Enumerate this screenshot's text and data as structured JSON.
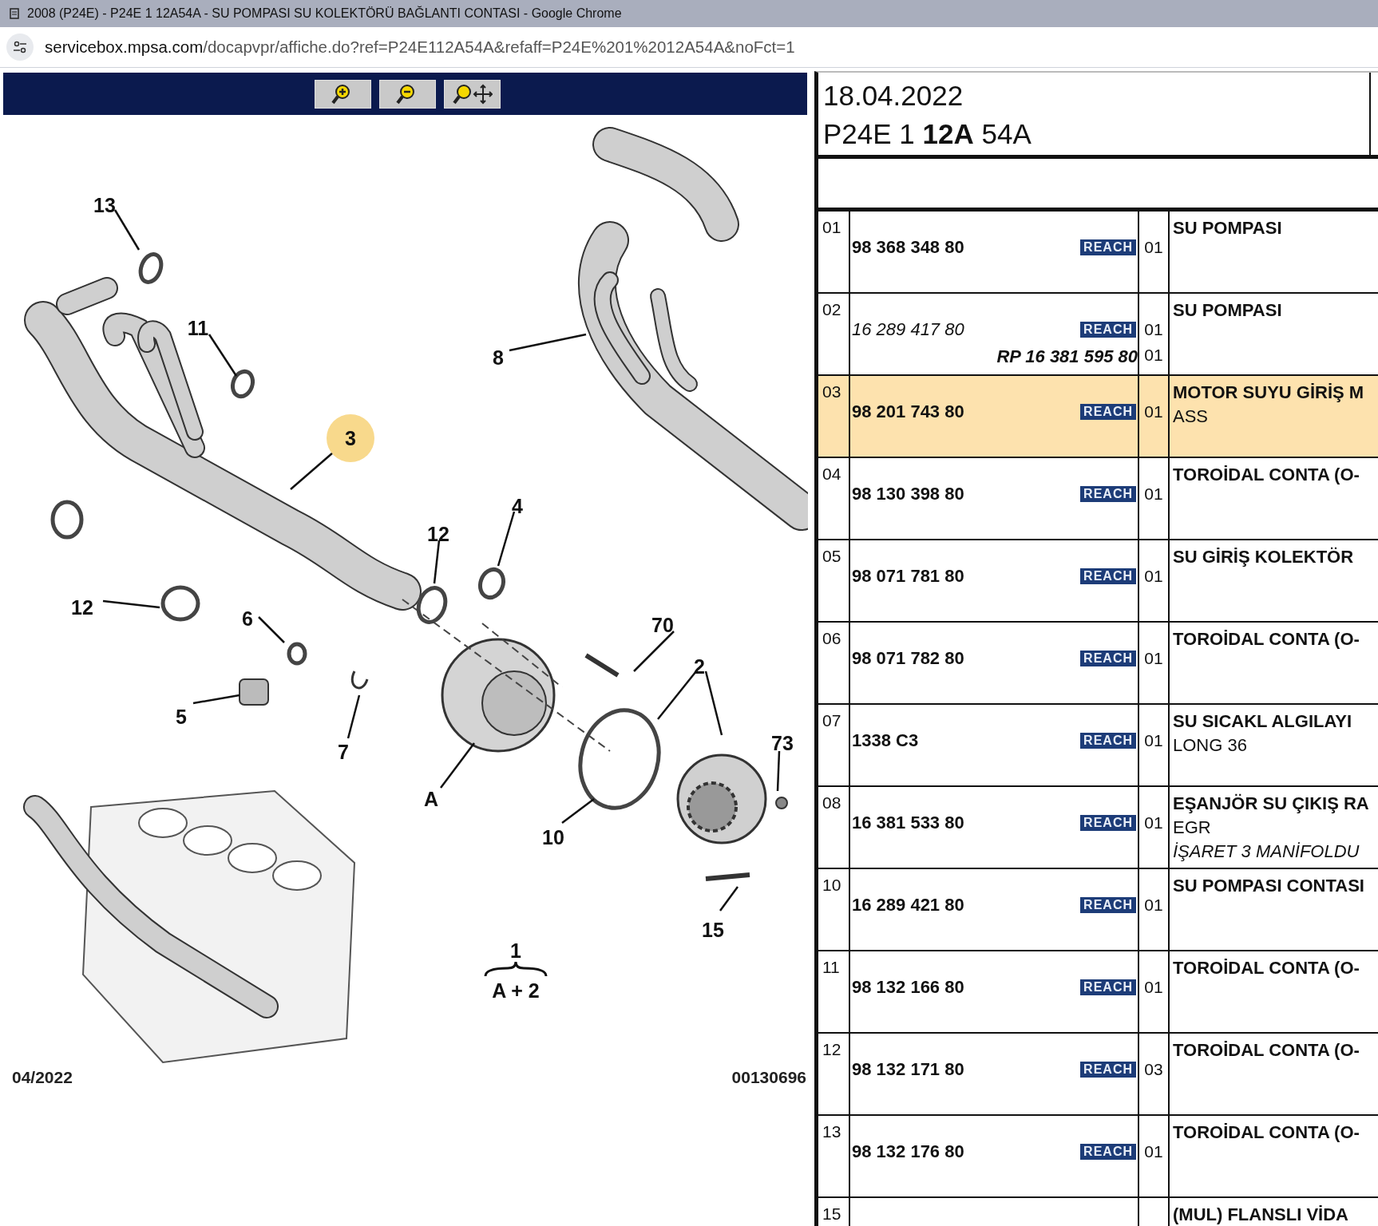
{
  "window": {
    "title": "2008 (P24E) - P24E 1 12A54A - SU POMPASI SU KOLEKTÖRÜ BAĞLANTI CONTASI - Google Chrome"
  },
  "address_bar": {
    "url_host": "servicebox.mpsa.com",
    "url_path": "/docapvpr/affiche.do?ref=P24E112A54A&refaff=P24E%201%2012A54A&noFct=1"
  },
  "toolbar": {
    "buttons": [
      {
        "kind": "zoom-in"
      },
      {
        "kind": "zoom-out"
      },
      {
        "kind": "pan"
      }
    ]
  },
  "diagram": {
    "callouts": [
      {
        "label": "13",
        "highlighted": false
      },
      {
        "label": "11",
        "highlighted": false
      },
      {
        "label": "3",
        "highlighted": true
      },
      {
        "label": "8",
        "highlighted": false
      },
      {
        "label": "12",
        "highlighted": false
      },
      {
        "label": "4",
        "highlighted": false
      },
      {
        "label": "12",
        "highlighted": false
      },
      {
        "label": "6",
        "highlighted": false
      },
      {
        "label": "5",
        "highlighted": false
      },
      {
        "label": "7",
        "highlighted": false
      },
      {
        "label": "70",
        "highlighted": false
      },
      {
        "label": "2",
        "highlighted": false
      },
      {
        "label": "73",
        "highlighted": false
      },
      {
        "label": "A",
        "highlighted": false
      },
      {
        "label": "10",
        "highlighted": false
      },
      {
        "label": "15",
        "highlighted": false
      },
      {
        "label": "1",
        "highlighted": false
      },
      {
        "label": "A + 2",
        "highlighted": false
      }
    ],
    "date": "04/2022",
    "reference": "00130696"
  },
  "header": {
    "date": "18.04.2022",
    "code": "P24E 1 **12A** 54A"
  },
  "parts": [
    {
      "index": "01",
      "part_number": "98 368 348 80",
      "italic": false,
      "badge": "REACH",
      "quantity": "01",
      "selected": false,
      "description": [
        {
          "text": "SU POMPASI",
          "italic": false
        }
      ]
    },
    {
      "index": "02",
      "part_number": "16 289 417 80",
      "italic": true,
      "badge": "REACH",
      "quantity": "01",
      "selected": false,
      "replacement": {
        "part_number": "RP 16 381 595 80",
        "quantity": "01"
      },
      "description": [
        {
          "text": "SU POMPASI",
          "italic": false
        }
      ]
    },
    {
      "index": "03",
      "part_number": "98 201 743 80",
      "italic": false,
      "badge": "REACH",
      "quantity": "01",
      "selected": true,
      "description": [
        {
          "text": "MOTOR SUYU GİRİŞ M",
          "italic": false
        },
        {
          "text": "ASS",
          "italic": false
        }
      ]
    },
    {
      "index": "04",
      "part_number": "98 130 398 80",
      "italic": false,
      "badge": "REACH",
      "quantity": "01",
      "selected": false,
      "description": [
        {
          "text": "TOROİDAL CONTA (O-",
          "italic": false
        }
      ]
    },
    {
      "index": "05",
      "part_number": "98 071 781 80",
      "italic": false,
      "badge": "REACH",
      "quantity": "01",
      "selected": false,
      "description": [
        {
          "text": "SU GİRİŞ KOLEKTÖR",
          "italic": false
        }
      ]
    },
    {
      "index": "06",
      "part_number": "98 071 782 80",
      "italic": false,
      "badge": "REACH",
      "quantity": "01",
      "selected": false,
      "description": [
        {
          "text": "TOROİDAL CONTA (O-",
          "italic": false
        }
      ]
    },
    {
      "index": "07",
      "part_number": "1338 C3",
      "italic": false,
      "badge": "REACH",
      "quantity": "01",
      "selected": false,
      "description": [
        {
          "text": "SU SICAKL ALGILAYI",
          "italic": false
        },
        {
          "text": "LONG 36",
          "italic": false
        }
      ]
    },
    {
      "index": "08",
      "part_number": "16 381 533 80",
      "italic": false,
      "badge": "REACH",
      "quantity": "01",
      "selected": false,
      "description": [
        {
          "text": "EŞANJÖR SU ÇIKIŞ RA",
          "italic": false
        },
        {
          "text": "EGR",
          "italic": false
        },
        {
          "text": "İŞARET 3 MANİFOLDU",
          "italic": true
        }
      ]
    },
    {
      "index": "10",
      "part_number": "16 289 421 80",
      "italic": false,
      "badge": "REACH",
      "quantity": "01",
      "selected": false,
      "description": [
        {
          "text": "SU POMPASI CONTASI",
          "italic": false
        }
      ]
    },
    {
      "index": "11",
      "part_number": "98 132 166 80",
      "italic": false,
      "badge": "REACH",
      "quantity": "01",
      "selected": false,
      "description": [
        {
          "text": "TOROİDAL CONTA (O-",
          "italic": false
        }
      ]
    },
    {
      "index": "12",
      "part_number": "98 132 171 80",
      "italic": false,
      "badge": "REACH",
      "quantity": "03",
      "selected": false,
      "description": [
        {
          "text": "TOROİDAL CONTA (O-",
          "italic": false
        }
      ]
    },
    {
      "index": "13",
      "part_number": "98 132 176 80",
      "italic": false,
      "badge": "REACH",
      "quantity": "01",
      "selected": false,
      "description": [
        {
          "text": "TOROİDAL CONTA (O-",
          "italic": false
        }
      ]
    },
    {
      "index": "15",
      "selected": false,
      "description": [
        {
          "text": "(MUL) FLANSLI VİDA",
          "italic": false
        }
      ]
    }
  ]
}
